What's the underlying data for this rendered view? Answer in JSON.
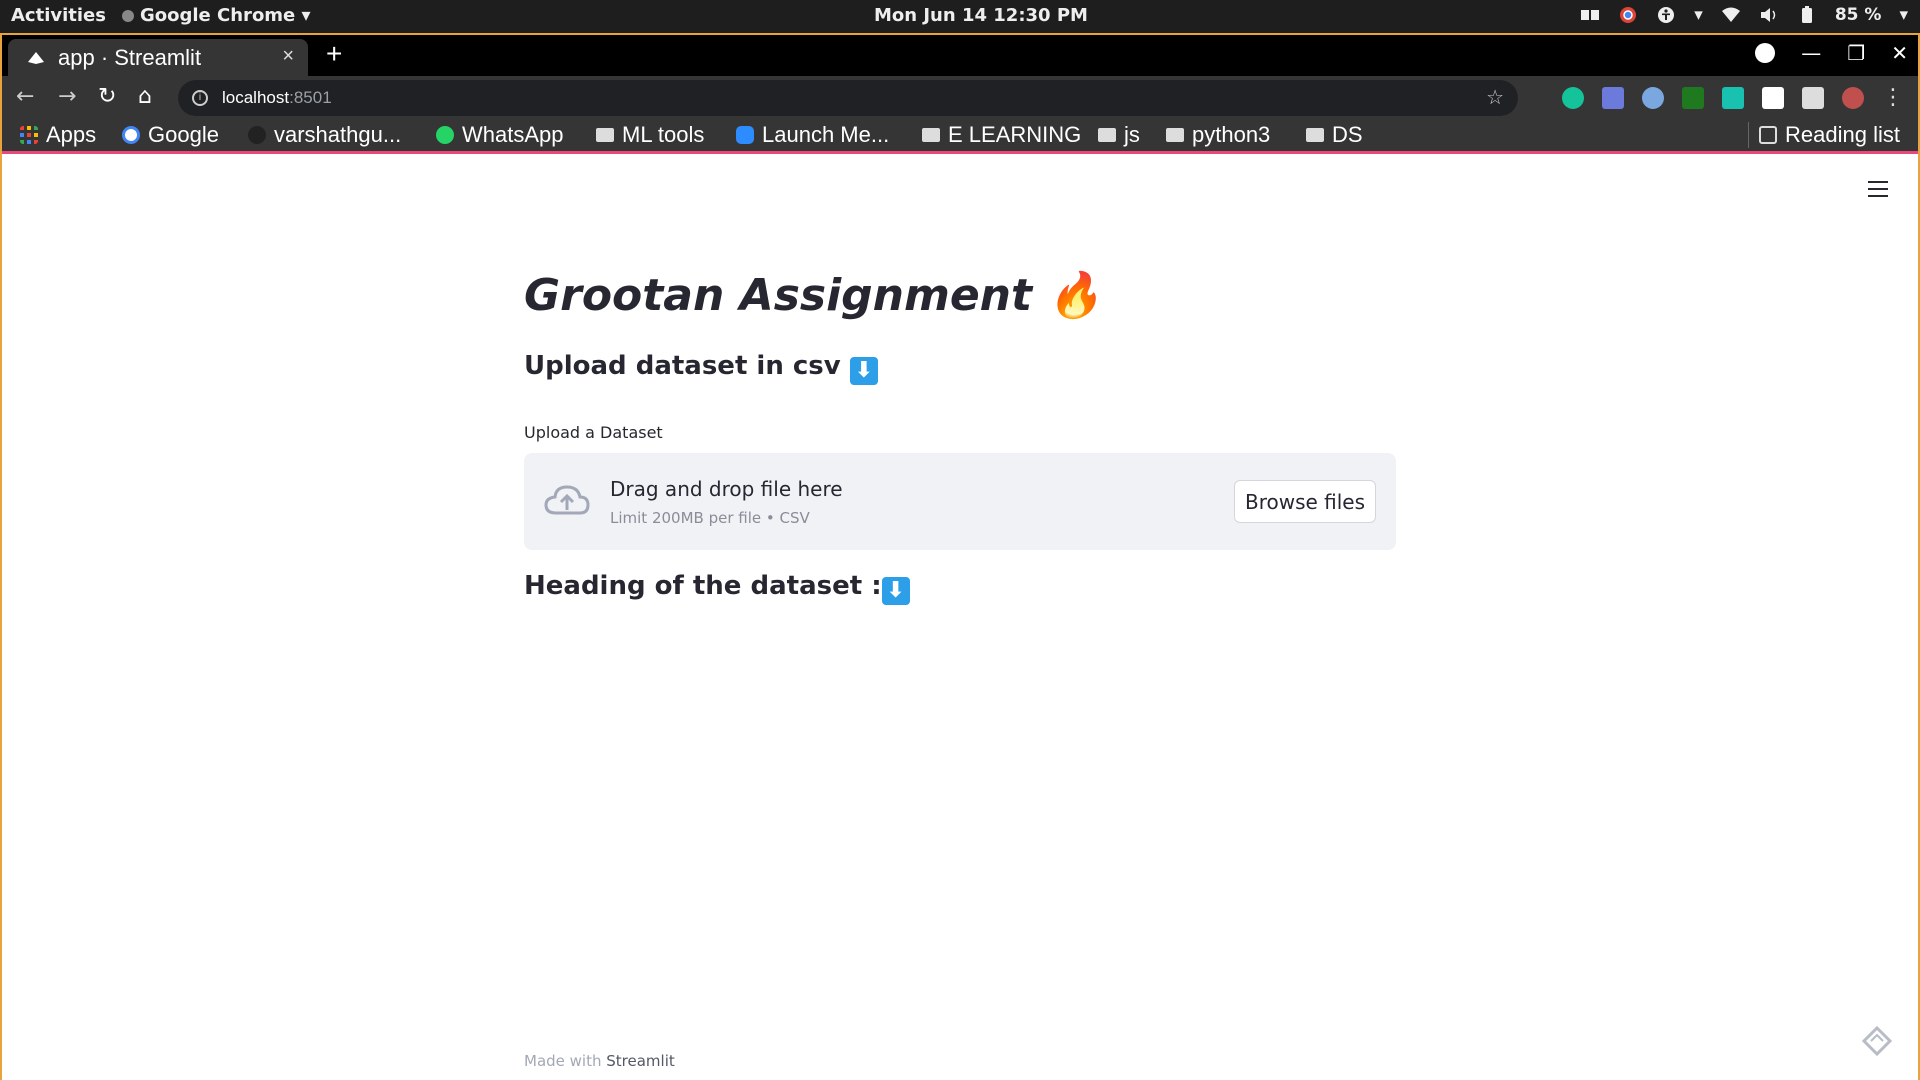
{
  "system_bar": {
    "activities": "Activities",
    "app_menu": "Google Chrome ▾",
    "clock": "Mon Jun 14  12:30 PM",
    "battery": "85 %"
  },
  "browser": {
    "tab_title": "app · Streamlit",
    "tab_close": "×",
    "new_tab": "+",
    "url_host": "localhost",
    "url_port": ":8501",
    "bookmarks": [
      {
        "label": "Apps"
      },
      {
        "label": "Google"
      },
      {
        "label": "varshathgu..."
      },
      {
        "label": "WhatsApp"
      },
      {
        "label": "ML tools"
      },
      {
        "label": "Launch Me..."
      },
      {
        "label": "E LEARNING"
      },
      {
        "label": "js"
      },
      {
        "label": "python3"
      },
      {
        "label": "DS"
      }
    ],
    "reading_list": "Reading list"
  },
  "app": {
    "title": "Grootan Assignment 🔥",
    "upload_heading": "Upload dataset in csv",
    "upload_label": "Upload a Dataset",
    "dropzone_title": "Drag and drop file here",
    "dropzone_limit": "Limit 200MB per file • CSV",
    "browse_button": "Browse files",
    "dataset_heading": "Heading of the dataset :",
    "footer_prefix": "Made with ",
    "footer_brand": "Streamlit"
  },
  "icons": [
    "grid-apps-icon",
    "google-icon",
    "github-icon",
    "whatsapp-icon",
    "folder-icon",
    "zoom-icon",
    "cloud-upload-icon",
    "hamburger-menu-icon",
    "streamlit-logo-icon"
  ],
  "colors": {
    "accent": "#e8497a",
    "window_border": "#e8a33d",
    "dropzone_bg": "#f0f2f6",
    "arrow_emoji": "#2d9fe8"
  }
}
